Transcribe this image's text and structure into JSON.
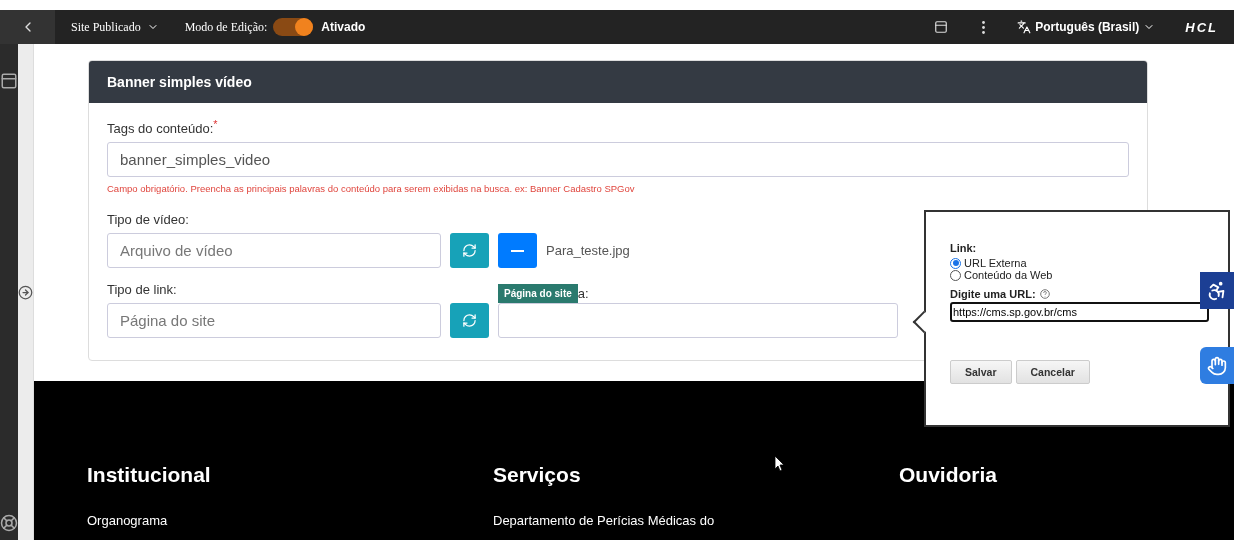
{
  "topbar": {
    "site_menu": "Site Publicado",
    "edit_mode_label": "Modo de Edição:",
    "edit_mode": {
      "on": true,
      "label": "Ativado"
    },
    "language": "Português (Brasil)",
    "logo": "HCL"
  },
  "card": {
    "title": "Banner simples vídeo",
    "tags": {
      "label": "Tags do conteúdo:",
      "required_mark": "*",
      "value": "banner_simples_video",
      "help": "Campo obrigatório. Preencha as principais palavras do conteúdo para serem exibidas na busca. ex: Banner Cadastro SPGov"
    },
    "video": {
      "label": "Tipo de vídeo:",
      "placeholder": "Arquivo de vídeo",
      "file": "Para_teste.jpg"
    },
    "link": {
      "label": "Tipo de link:",
      "placeholder": "Página do site",
      "tooltip": "Página do site",
      "second_label": "a:"
    }
  },
  "popup": {
    "title": "Link:",
    "options": [
      {
        "label": "URL Externa",
        "selected": true
      },
      {
        "label": "Conteúdo da Web",
        "selected": false
      }
    ],
    "url_label": "Digite uma URL:",
    "url_value": "https://cms.sp.gov.br/cms",
    "buttons": [
      "Salvar",
      "Cancelar"
    ]
  },
  "footer": {
    "columns": [
      {
        "heading": "Institucional",
        "links": [
          "Organograma"
        ]
      },
      {
        "heading": "Serviços",
        "links": [
          "Departamento de Perícias Médicas do"
        ]
      },
      {
        "heading": "Ouvidoria"
      }
    ]
  }
}
